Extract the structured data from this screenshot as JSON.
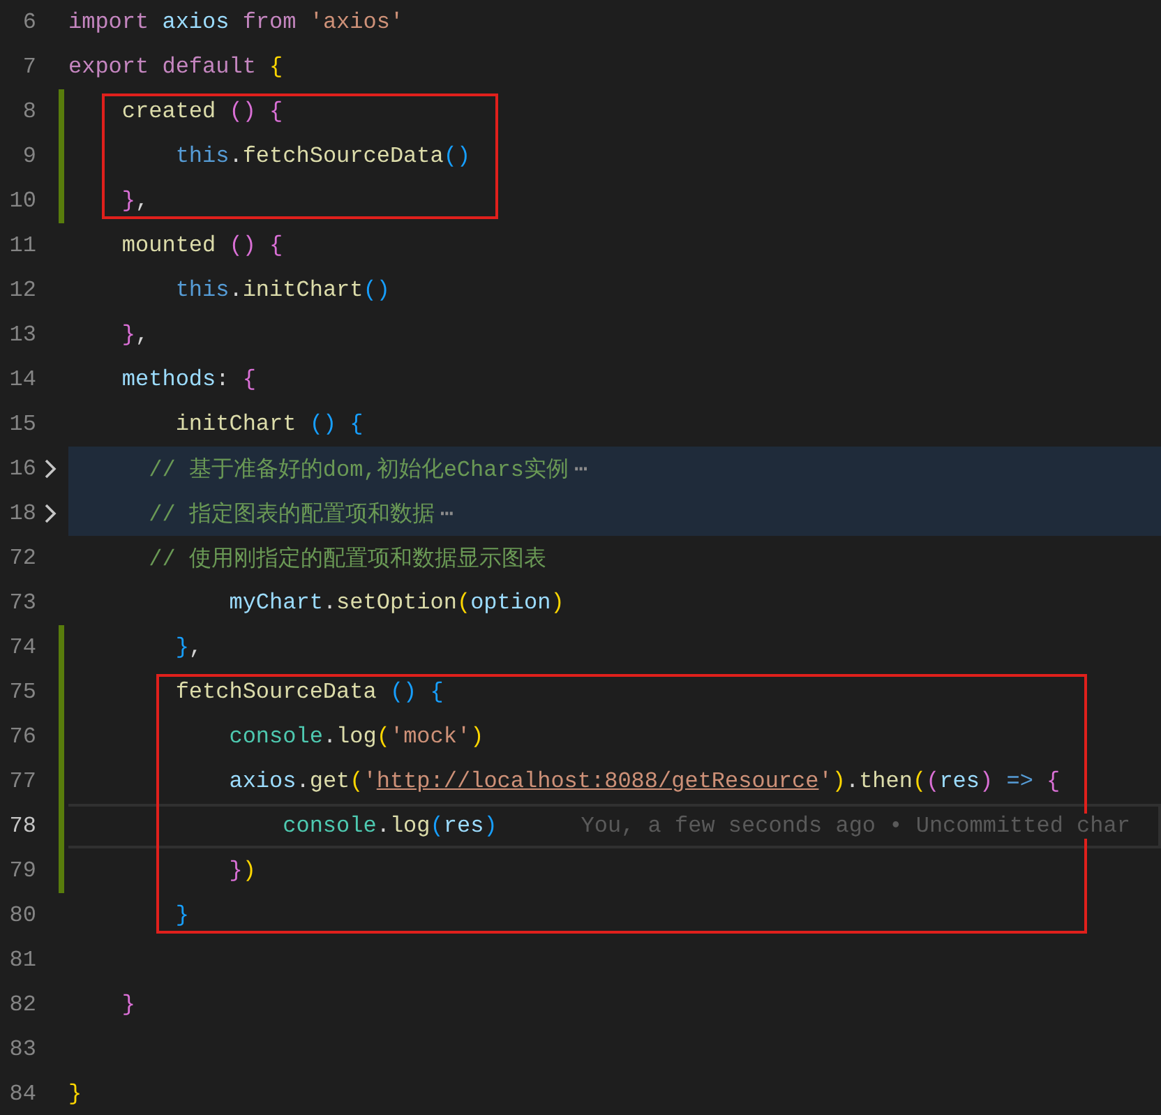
{
  "lines": [
    {
      "kind": "line",
      "number": "6",
      "tokens": [
        {
          "kind": "keyword",
          "text": "import"
        },
        {
          "kind": "variable",
          "text": " axios"
        },
        {
          "kind": "keyword",
          "text": " from"
        },
        {
          "kind": "string",
          "text": " 'axios'"
        }
      ]
    },
    {
      "kind": "line",
      "number": "7",
      "tokens": [
        {
          "kind": "keyword",
          "text": "export default"
        },
        {
          "kind": "bracket1",
          "text": " {"
        }
      ]
    },
    {
      "kind": "red_box",
      "lines": [
        {
          "kind": "line",
          "number": "8",
          "changed": true,
          "tokens": [
            {
              "kind": "function",
              "text": "    created"
            },
            {
              "kind": "bracket2",
              "text": " ()"
            },
            {
              "kind": "bracket2",
              "text": " {"
            }
          ]
        },
        {
          "kind": "line",
          "number": "9",
          "changed": true,
          "tokens": [
            {
              "kind": "this",
              "text": "        this"
            },
            {
              "kind": "plain",
              "text": "."
            },
            {
              "kind": "function",
              "text": "fetchSourceData"
            },
            {
              "kind": "bracket3",
              "text": "()"
            }
          ]
        },
        {
          "kind": "line",
          "number": "10",
          "changed": true,
          "tokens": [
            {
              "kind": "bracket2",
              "text": "    }"
            },
            {
              "kind": "plain",
              "text": ","
            }
          ]
        }
      ]
    },
    {
      "kind": "line",
      "number": "11",
      "tokens": [
        {
          "kind": "function",
          "text": "    mounted"
        },
        {
          "kind": "bracket2",
          "text": " ()"
        },
        {
          "kind": "bracket2",
          "text": " {"
        }
      ]
    },
    {
      "kind": "line",
      "number": "12",
      "tokens": [
        {
          "kind": "this",
          "text": "        this"
        },
        {
          "kind": "plain",
          "text": "."
        },
        {
          "kind": "function",
          "text": "initChart"
        },
        {
          "kind": "bracket3",
          "text": "()"
        }
      ]
    },
    {
      "kind": "line",
      "number": "13",
      "tokens": [
        {
          "kind": "bracket2",
          "text": "    }"
        },
        {
          "kind": "plain",
          "text": ","
        }
      ]
    },
    {
      "kind": "line",
      "number": "14",
      "tokens": [
        {
          "kind": "variable",
          "text": "    methods"
        },
        {
          "kind": "plain",
          "text": ":"
        },
        {
          "kind": "bracket2",
          "text": " {"
        }
      ]
    },
    {
      "kind": "line",
      "number": "15",
      "tokens": [
        {
          "kind": "function",
          "text": "        initChart"
        },
        {
          "kind": "bracket3",
          "text": " ()"
        },
        {
          "kind": "bracket3",
          "text": " {"
        }
      ]
    },
    {
      "kind": "line",
      "number": "16",
      "folded": true,
      "fold_text": "⋯",
      "tokens": [
        {
          "kind": "comment",
          "text": "      // 基于准备好的dom,初始化eChars实例"
        }
      ]
    },
    {
      "kind": "line",
      "number": "18",
      "folded": true,
      "fold_text": "⋯",
      "tokens": [
        {
          "kind": "comment",
          "text": "      // 指定图表的配置项和数据"
        }
      ]
    },
    {
      "kind": "line",
      "number": "72",
      "tokens": [
        {
          "kind": "comment",
          "text": "      // 使用刚指定的配置项和数据显示图表"
        }
      ]
    },
    {
      "kind": "line",
      "number": "73",
      "tokens": [
        {
          "kind": "variable",
          "text": "            myChart"
        },
        {
          "kind": "plain",
          "text": "."
        },
        {
          "kind": "function",
          "text": "setOption"
        },
        {
          "kind": "bracket1",
          "text": "("
        },
        {
          "kind": "variable",
          "text": "option"
        },
        {
          "kind": "bracket1",
          "text": ")"
        }
      ]
    },
    {
      "kind": "line",
      "number": "74",
      "changed": true,
      "tokens": [
        {
          "kind": "bracket3",
          "text": "        }"
        },
        {
          "kind": "plain",
          "text": ","
        }
      ]
    },
    {
      "kind": "red_box",
      "lines": [
        {
          "kind": "line",
          "number": "75",
          "changed": true,
          "tokens": [
            {
              "kind": "function",
              "text": "        fetchSourceData"
            },
            {
              "kind": "bracket3",
              "text": " ()"
            },
            {
              "kind": "bracket3",
              "text": " {"
            }
          ]
        },
        {
          "kind": "line",
          "number": "76",
          "changed": true,
          "tokens": [
            {
              "kind": "class",
              "text": "            console"
            },
            {
              "kind": "plain",
              "text": "."
            },
            {
              "kind": "function",
              "text": "log"
            },
            {
              "kind": "bracket1",
              "text": "("
            },
            {
              "kind": "string",
              "text": "'mock'"
            },
            {
              "kind": "bracket1",
              "text": ")"
            }
          ]
        },
        {
          "kind": "line",
          "number": "77",
          "changed": true,
          "tokens": [
            {
              "kind": "variable",
              "text": "            axios"
            },
            {
              "kind": "plain",
              "text": "."
            },
            {
              "kind": "function",
              "text": "get"
            },
            {
              "kind": "bracket1",
              "text": "("
            },
            {
              "kind": "string",
              "text": "'"
            },
            {
              "kind": "link",
              "text": "http://localhost:8088/getResource"
            },
            {
              "kind": "string",
              "text": "'"
            },
            {
              "kind": "bracket1",
              "text": ")"
            },
            {
              "kind": "plain",
              "text": "."
            },
            {
              "kind": "function",
              "text": "then"
            },
            {
              "kind": "bracket1",
              "text": "("
            },
            {
              "kind": "bracket2",
              "text": "("
            },
            {
              "kind": "variable",
              "text": "res"
            },
            {
              "kind": "bracket2",
              "text": ")"
            },
            {
              "kind": "arrow",
              "text": " =>"
            },
            {
              "kind": "bracket2",
              "text": " {"
            }
          ]
        },
        {
          "kind": "line",
          "number": "78",
          "changed": true,
          "current": true,
          "blame": "You, a few seconds ago • Uncommitted char",
          "tokens": [
            {
              "kind": "class",
              "text": "                console"
            },
            {
              "kind": "plain",
              "text": "."
            },
            {
              "kind": "function",
              "text": "log"
            },
            {
              "kind": "bracket3",
              "text": "("
            },
            {
              "kind": "variable",
              "text": "res"
            },
            {
              "kind": "bracket3",
              "text": ")"
            }
          ]
        },
        {
          "kind": "line",
          "number": "79",
          "changed": true,
          "tokens": [
            {
              "kind": "bracket2",
              "text": "            }"
            },
            {
              "kind": "bracket1",
              "text": ")"
            }
          ]
        },
        {
          "kind": "line",
          "number": "80",
          "tokens": [
            {
              "kind": "bracket3",
              "text": "        }"
            }
          ]
        }
      ]
    },
    {
      "kind": "line",
      "number": "81"
    },
    {
      "kind": "line",
      "number": "82",
      "tokens": [
        {
          "kind": "bracket2",
          "text": "    }"
        }
      ]
    },
    {
      "kind": "line",
      "number": "83"
    },
    {
      "kind": "line",
      "number": "84",
      "tokens": [
        {
          "kind": "bracket1",
          "text": "}"
        }
      ]
    }
  ]
}
